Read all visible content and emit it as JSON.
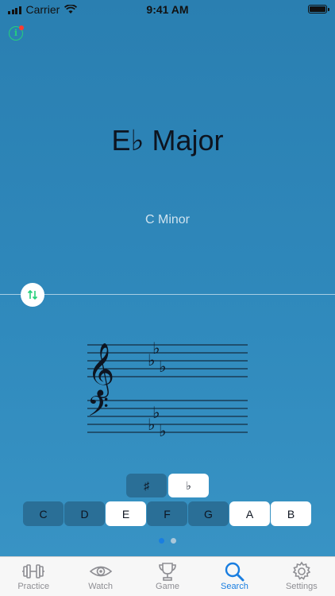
{
  "status_bar": {
    "carrier": "Carrier",
    "time": "9:41 AM"
  },
  "info_icon": "i",
  "key": {
    "title": "E♭ Major",
    "relative": "C Minor"
  },
  "staff_flats": [
    "♭",
    "♭",
    "♭"
  ],
  "accidental_toggle": [
    {
      "label": "♯",
      "selected": false
    },
    {
      "label": "♭",
      "selected": true
    }
  ],
  "notes": [
    {
      "label": "C",
      "selected": false
    },
    {
      "label": "D",
      "selected": false
    },
    {
      "label": "E",
      "selected": true
    },
    {
      "label": "F",
      "selected": false
    },
    {
      "label": "G",
      "selected": false
    },
    {
      "label": "A",
      "selected": true
    },
    {
      "label": "B",
      "selected": true
    }
  ],
  "page_indicator": {
    "pages": 2,
    "current": 1
  },
  "tabs": [
    {
      "label": "Practice",
      "icon": "dumbbell-icon"
    },
    {
      "label": "Watch",
      "icon": "eye-icon"
    },
    {
      "label": "Game",
      "icon": "trophy-icon"
    },
    {
      "label": "Search",
      "icon": "search-icon"
    },
    {
      "label": "Settings",
      "icon": "gear-icon"
    }
  ],
  "colors": {
    "accent": "#1a7ee0",
    "info": "#25d07a",
    "badge": "#ff3b30",
    "selected_segment": "#ffffff",
    "unselected_segment": "#2a6f97"
  }
}
